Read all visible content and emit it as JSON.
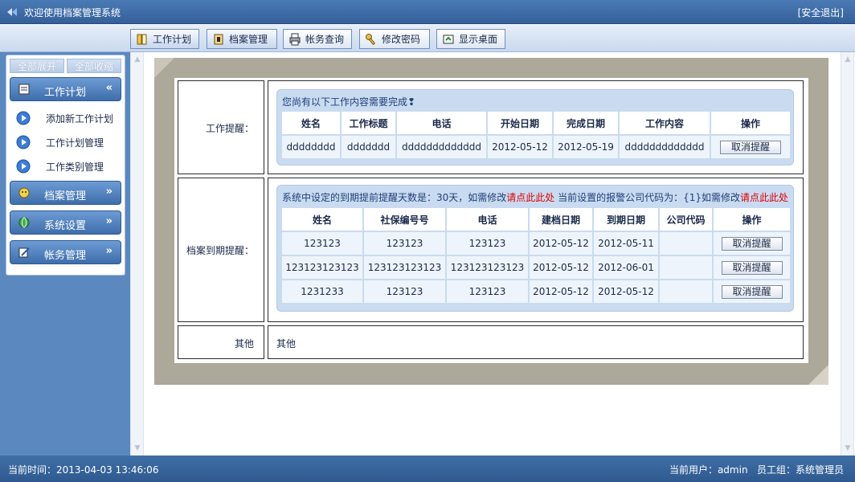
{
  "header": {
    "title": "欢迎使用档案管理系统",
    "logout": "[安全退出]"
  },
  "toolbar": {
    "buttons": [
      {
        "label": "工作计划",
        "icon": "book-icon"
      },
      {
        "label": "档案管理",
        "icon": "folder-icon"
      },
      {
        "label": "帐务查询",
        "icon": "printer-icon"
      },
      {
        "label": "修改密码",
        "icon": "key-icon"
      },
      {
        "label": "显示桌面",
        "icon": "desktop-icon"
      }
    ]
  },
  "sidebar": {
    "expand_all": "全部展开",
    "collapse_all": "全部收缩",
    "menus": [
      {
        "label": "工作计划",
        "icon": "list-icon",
        "chevron": "«"
      },
      {
        "label": "档案管理",
        "icon": "smiley-icon",
        "chevron": "»"
      },
      {
        "label": "系统设置",
        "icon": "globe-icon",
        "chevron": "»"
      },
      {
        "label": "帐务管理",
        "icon": "edit-icon",
        "chevron": "»"
      }
    ],
    "sub_items": [
      "添加新工作计划",
      "工作计划管理",
      "工作类别管理"
    ]
  },
  "work_reminder": {
    "label": "工作提醒：",
    "heading": "您尚有以下工作内容需要完成",
    "heading_mark": "❢",
    "columns": [
      "姓名",
      "工作标题",
      "电话",
      "开始日期",
      "完成日期",
      "工作内容",
      "操作"
    ],
    "rows": [
      [
        "dddddddd",
        "ddddddd",
        "ddddddddddddd",
        "2012-05-12",
        "2012-05-19",
        "ddddddddddddd"
      ]
    ],
    "action_label": "取消提醒"
  },
  "archive_reminder": {
    "label": "档案到期提醒：",
    "heading_part1": "系统中设定的到期提前提醒天数是：30天，如需修改",
    "heading_link1": "请点此此处",
    "heading_part2": " 当前设置的报警公司代码为：{1}如需修改",
    "heading_link2": "请点此此处",
    "columns": [
      "姓名",
      "社保编号号",
      "电话",
      "建档日期",
      "到期日期",
      "公司代码",
      "操作"
    ],
    "rows": [
      [
        "123123",
        "123123",
        "123123",
        "2012-05-12",
        "2012-05-11",
        ""
      ],
      [
        "123123123123",
        "123123123123",
        "123123123123",
        "2012-05-12",
        "2012-06-01",
        ""
      ],
      [
        "1231233",
        "123123",
        "123123",
        "2012-05-12",
        "2012-05-12",
        ""
      ]
    ],
    "action_label": "取消提醒"
  },
  "other": {
    "label": "其他",
    "content": "其他"
  },
  "status": {
    "time": "当前时间：2013-04-03 13:46:06",
    "user": "当前用户：admin   员工组：系统管理员"
  }
}
